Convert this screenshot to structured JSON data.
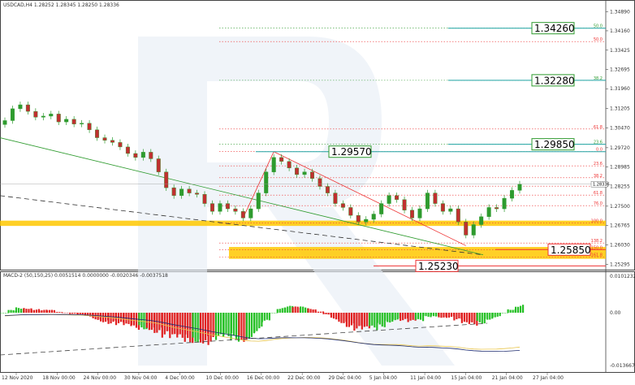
{
  "chart_data": [
    {
      "type": "candlestick",
      "title": "USDCAD,H4  1.28252 1.28345 1.28250 1.28336",
      "price_axis": {
        "ticks": [
          "1.34890",
          "1.34160",
          "1.33425",
          "1.32695",
          "1.31960",
          "1.31205",
          "1.30470",
          "1.29720",
          "1.28985",
          "1.28255",
          "1.27500",
          "1.26765",
          "1.26030",
          "1.25295"
        ],
        "ylim": [
          1.2515,
          1.3496
        ],
        "current_price": "1.28336"
      },
      "x_axis": {
        "ticks": [
          "12 Nov 2020",
          "18 Nov 00:00",
          "24 Nov 00:00",
          "30 Nov 04:00",
          "4 Dec 00:00",
          "10 Dec 00:00",
          "16 Dec 00:00",
          "22 Dec 00:00",
          "29 Dec 04:00",
          "5 Jan 04:00",
          "11 Jan 04:00",
          "15 Jan 04:00",
          "21 Jan 04:00",
          "27 Jan 04:00"
        ]
      },
      "close_path": [
        [
          "12 Nov 2020",
          1.3075
        ],
        [
          null,
          1.312
        ],
        [
          null,
          1.3135
        ],
        [
          null,
          1.311
        ],
        [
          null,
          1.3088
        ],
        [
          "18 Nov 00:00",
          1.3092
        ],
        [
          null,
          1.31
        ],
        [
          null,
          1.307
        ],
        [
          null,
          1.308
        ],
        [
          null,
          1.3062
        ],
        [
          "24 Nov 00:00",
          1.3065
        ],
        [
          null,
          1.304
        ],
        [
          null,
          1.301
        ],
        [
          null,
          1.3
        ],
        [
          null,
          1.2992
        ],
        [
          "30 Nov 04:00",
          1.2975
        ],
        [
          null,
          1.295
        ],
        [
          null,
          1.2935
        ],
        [
          null,
          1.2955
        ],
        [
          null,
          1.293
        ],
        [
          "4 Dec 00:00",
          1.288
        ],
        [
          null,
          1.282
        ],
        [
          null,
          1.279
        ],
        [
          null,
          1.2815
        ],
        [
          null,
          1.28
        ],
        [
          "10 Dec 00:00",
          1.2795
        ],
        [
          null,
          1.276
        ],
        [
          null,
          1.273
        ],
        [
          null,
          1.276
        ],
        [
          null,
          1.274
        ],
        [
          "16 Dec 00:00",
          1.273
        ],
        [
          null,
          1.2705
        ],
        [
          null,
          1.274
        ],
        [
          null,
          1.28
        ],
        [
          null,
          1.288
        ],
        [
          "22 Dec 00:00",
          1.2935
        ],
        [
          null,
          1.292
        ],
        [
          null,
          1.2895
        ],
        [
          null,
          1.287
        ],
        [
          null,
          1.288
        ],
        [
          "29 Dec 04:00",
          1.2855
        ],
        [
          null,
          1.2825
        ],
        [
          null,
          1.28
        ],
        [
          null,
          1.276
        ],
        [
          null,
          1.2745
        ],
        [
          "5 Jan 04:00",
          1.2715
        ],
        [
          null,
          1.269
        ],
        [
          null,
          1.27
        ],
        [
          null,
          1.272
        ],
        [
          null,
          1.276
        ],
        [
          "11 Jan 04:00",
          1.279
        ],
        [
          null,
          1.2775
        ],
        [
          null,
          1.2735
        ],
        [
          null,
          1.2705
        ],
        [
          null,
          1.274
        ],
        [
          "15 Jan 04:00",
          1.28
        ],
        [
          null,
          1.276
        ],
        [
          null,
          1.273
        ],
        [
          null,
          1.274
        ],
        [
          null,
          1.269
        ],
        [
          "21 Jan 04:00",
          1.264
        ],
        [
          null,
          1.268
        ],
        [
          null,
          1.271
        ],
        [
          null,
          1.2745
        ],
        [
          null,
          1.274
        ],
        [
          "27 Jan 04:00",
          1.278
        ],
        [
          null,
          1.281
        ],
        [
          null,
          1.2834
        ]
      ],
      "fibonacci_levels": [
        {
          "label": "50.0",
          "price": 1.3426,
          "color": "#2e9b2e"
        },
        {
          "label": "50.0",
          "price": 1.3375,
          "color": "#e33"
        },
        {
          "label": "38.2",
          "price": 1.3228,
          "color": "#2e9b2e"
        },
        {
          "label": "61.8",
          "price": 1.3043,
          "color": "#e33"
        },
        {
          "label": "23.6",
          "price": 1.2985,
          "color": "#2e9b2e"
        },
        {
          "label": "0.0",
          "price": 1.2957,
          "color": "#e33"
        },
        {
          "label": "23.6",
          "price": 1.2903,
          "color": "#e33"
        },
        {
          "label": "38.2",
          "price": 1.2858,
          "color": "#e33"
        },
        {
          "label": "50.0",
          "price": 1.2826,
          "color": "#e33"
        },
        {
          "label": "61.8",
          "price": 1.2792,
          "color": "#e33"
        },
        {
          "label": "76.0",
          "price": 1.2752,
          "color": "#e33"
        },
        {
          "label": "100.0",
          "price": 1.2686,
          "color": "#e33"
        },
        {
          "label": "138.2",
          "price": 1.261,
          "color": "#e33"
        },
        {
          "label": "150.0",
          "price": 1.2585,
          "color": "#e33"
        },
        {
          "label": "161.8",
          "price": 1.2557,
          "color": "#e33"
        }
      ],
      "price_boxes": [
        {
          "text": "1.34260",
          "price": 1.3426,
          "color": "#2e9b2e"
        },
        {
          "text": "1.32280",
          "price": 1.3228,
          "color": "#2e9b2e"
        },
        {
          "text": "1.29850",
          "price": 1.2985,
          "color": "#2e9b2e"
        },
        {
          "text": "1.29570",
          "price": 1.2957,
          "color": "#2e9b2e"
        },
        {
          "text": "1.25850",
          "price": 1.2585,
          "color": "#e33"
        },
        {
          "text": "1.25230",
          "price": 1.2523,
          "color": "#e33"
        }
      ],
      "support_zones": [
        {
          "from": 1.2675,
          "to": 1.2695
        },
        {
          "from": 1.255,
          "to": 1.2595
        }
      ]
    },
    {
      "type": "histogram",
      "title": "MACD-2 (50,150,25) 0.0051514 0.0000000 -0.0020346 -0.0037518",
      "y_axis": {
        "ticks": [
          "0.0101232",
          "0.00",
          "-0.0136676"
        ]
      }
    }
  ]
}
